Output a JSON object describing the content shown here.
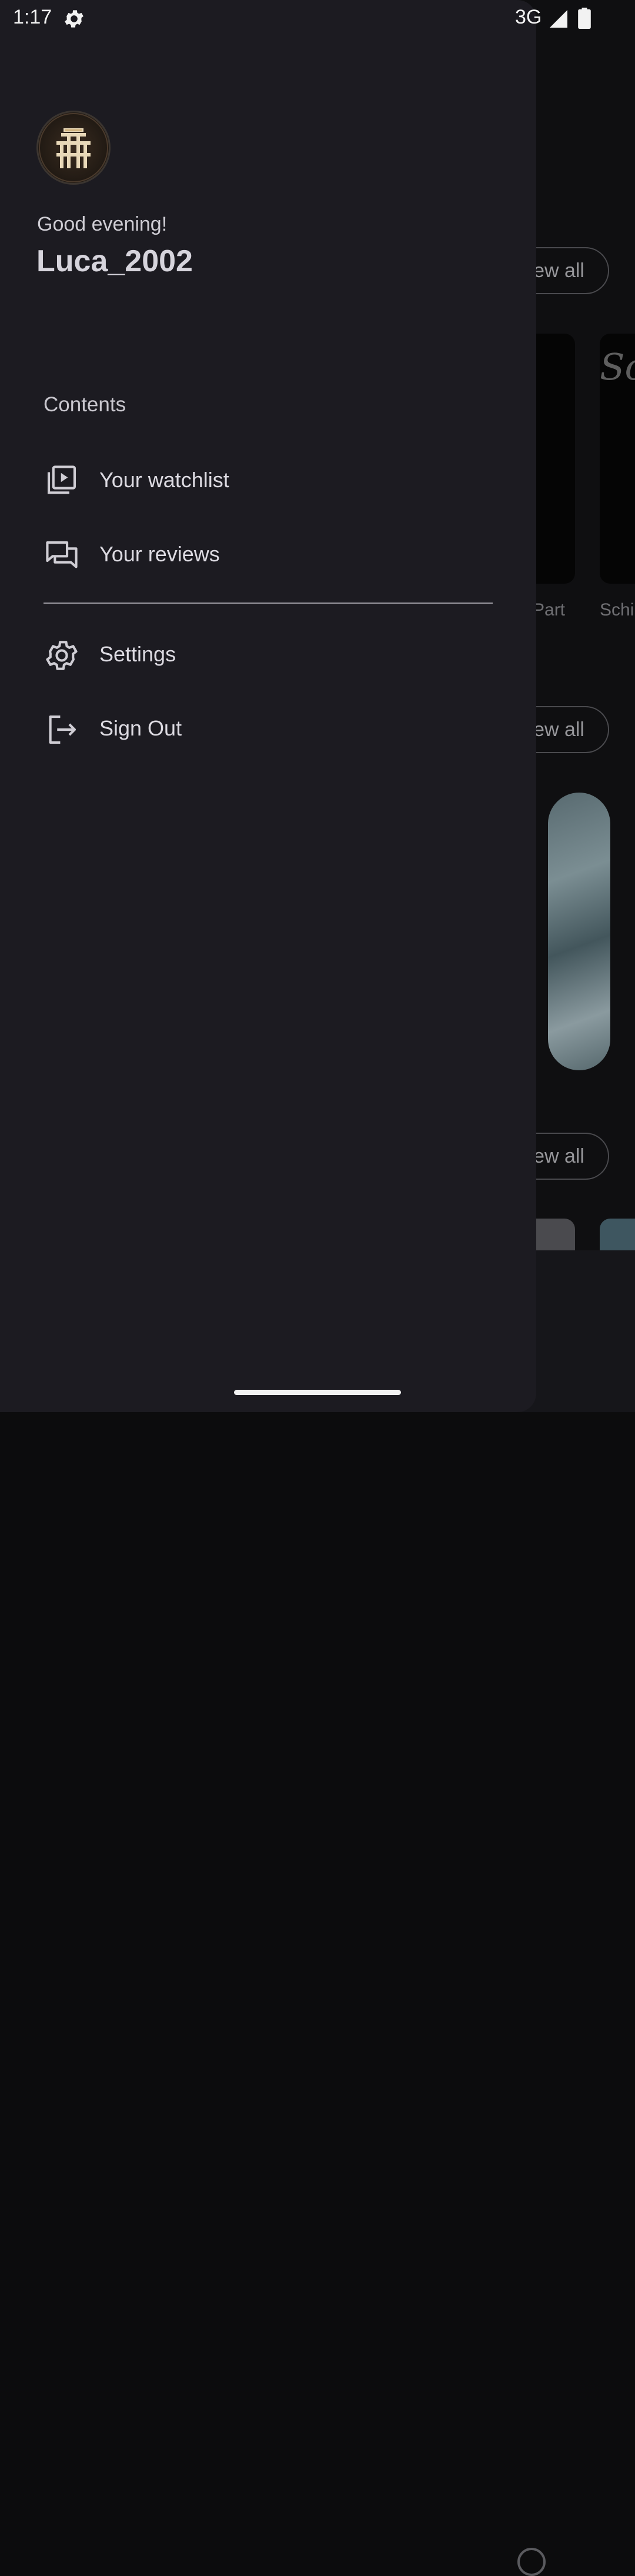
{
  "status_bar": {
    "time": "1:17",
    "network": "3G",
    "icons": [
      "settings-icon",
      "signal-icon",
      "battery-icon"
    ]
  },
  "drawer": {
    "greeting": "Good evening!",
    "username": "Luca_2002",
    "section_title": "Contents",
    "items": [
      {
        "label": "Your watchlist",
        "icon": "watchlist-icon"
      },
      {
        "label": "Your reviews",
        "icon": "reviews-icon"
      },
      {
        "label": "Settings",
        "icon": "settings-icon"
      },
      {
        "label": "Sign Out",
        "icon": "sign-out-icon"
      }
    ]
  },
  "background": {
    "view_all_label": "ew all",
    "captions": [
      "Part",
      "Schi"
    ],
    "poster_script": "Sc"
  },
  "colors": {
    "drawer_bg": "#1c1b21",
    "text": "#dddbe2",
    "background": "#0f0f11"
  }
}
